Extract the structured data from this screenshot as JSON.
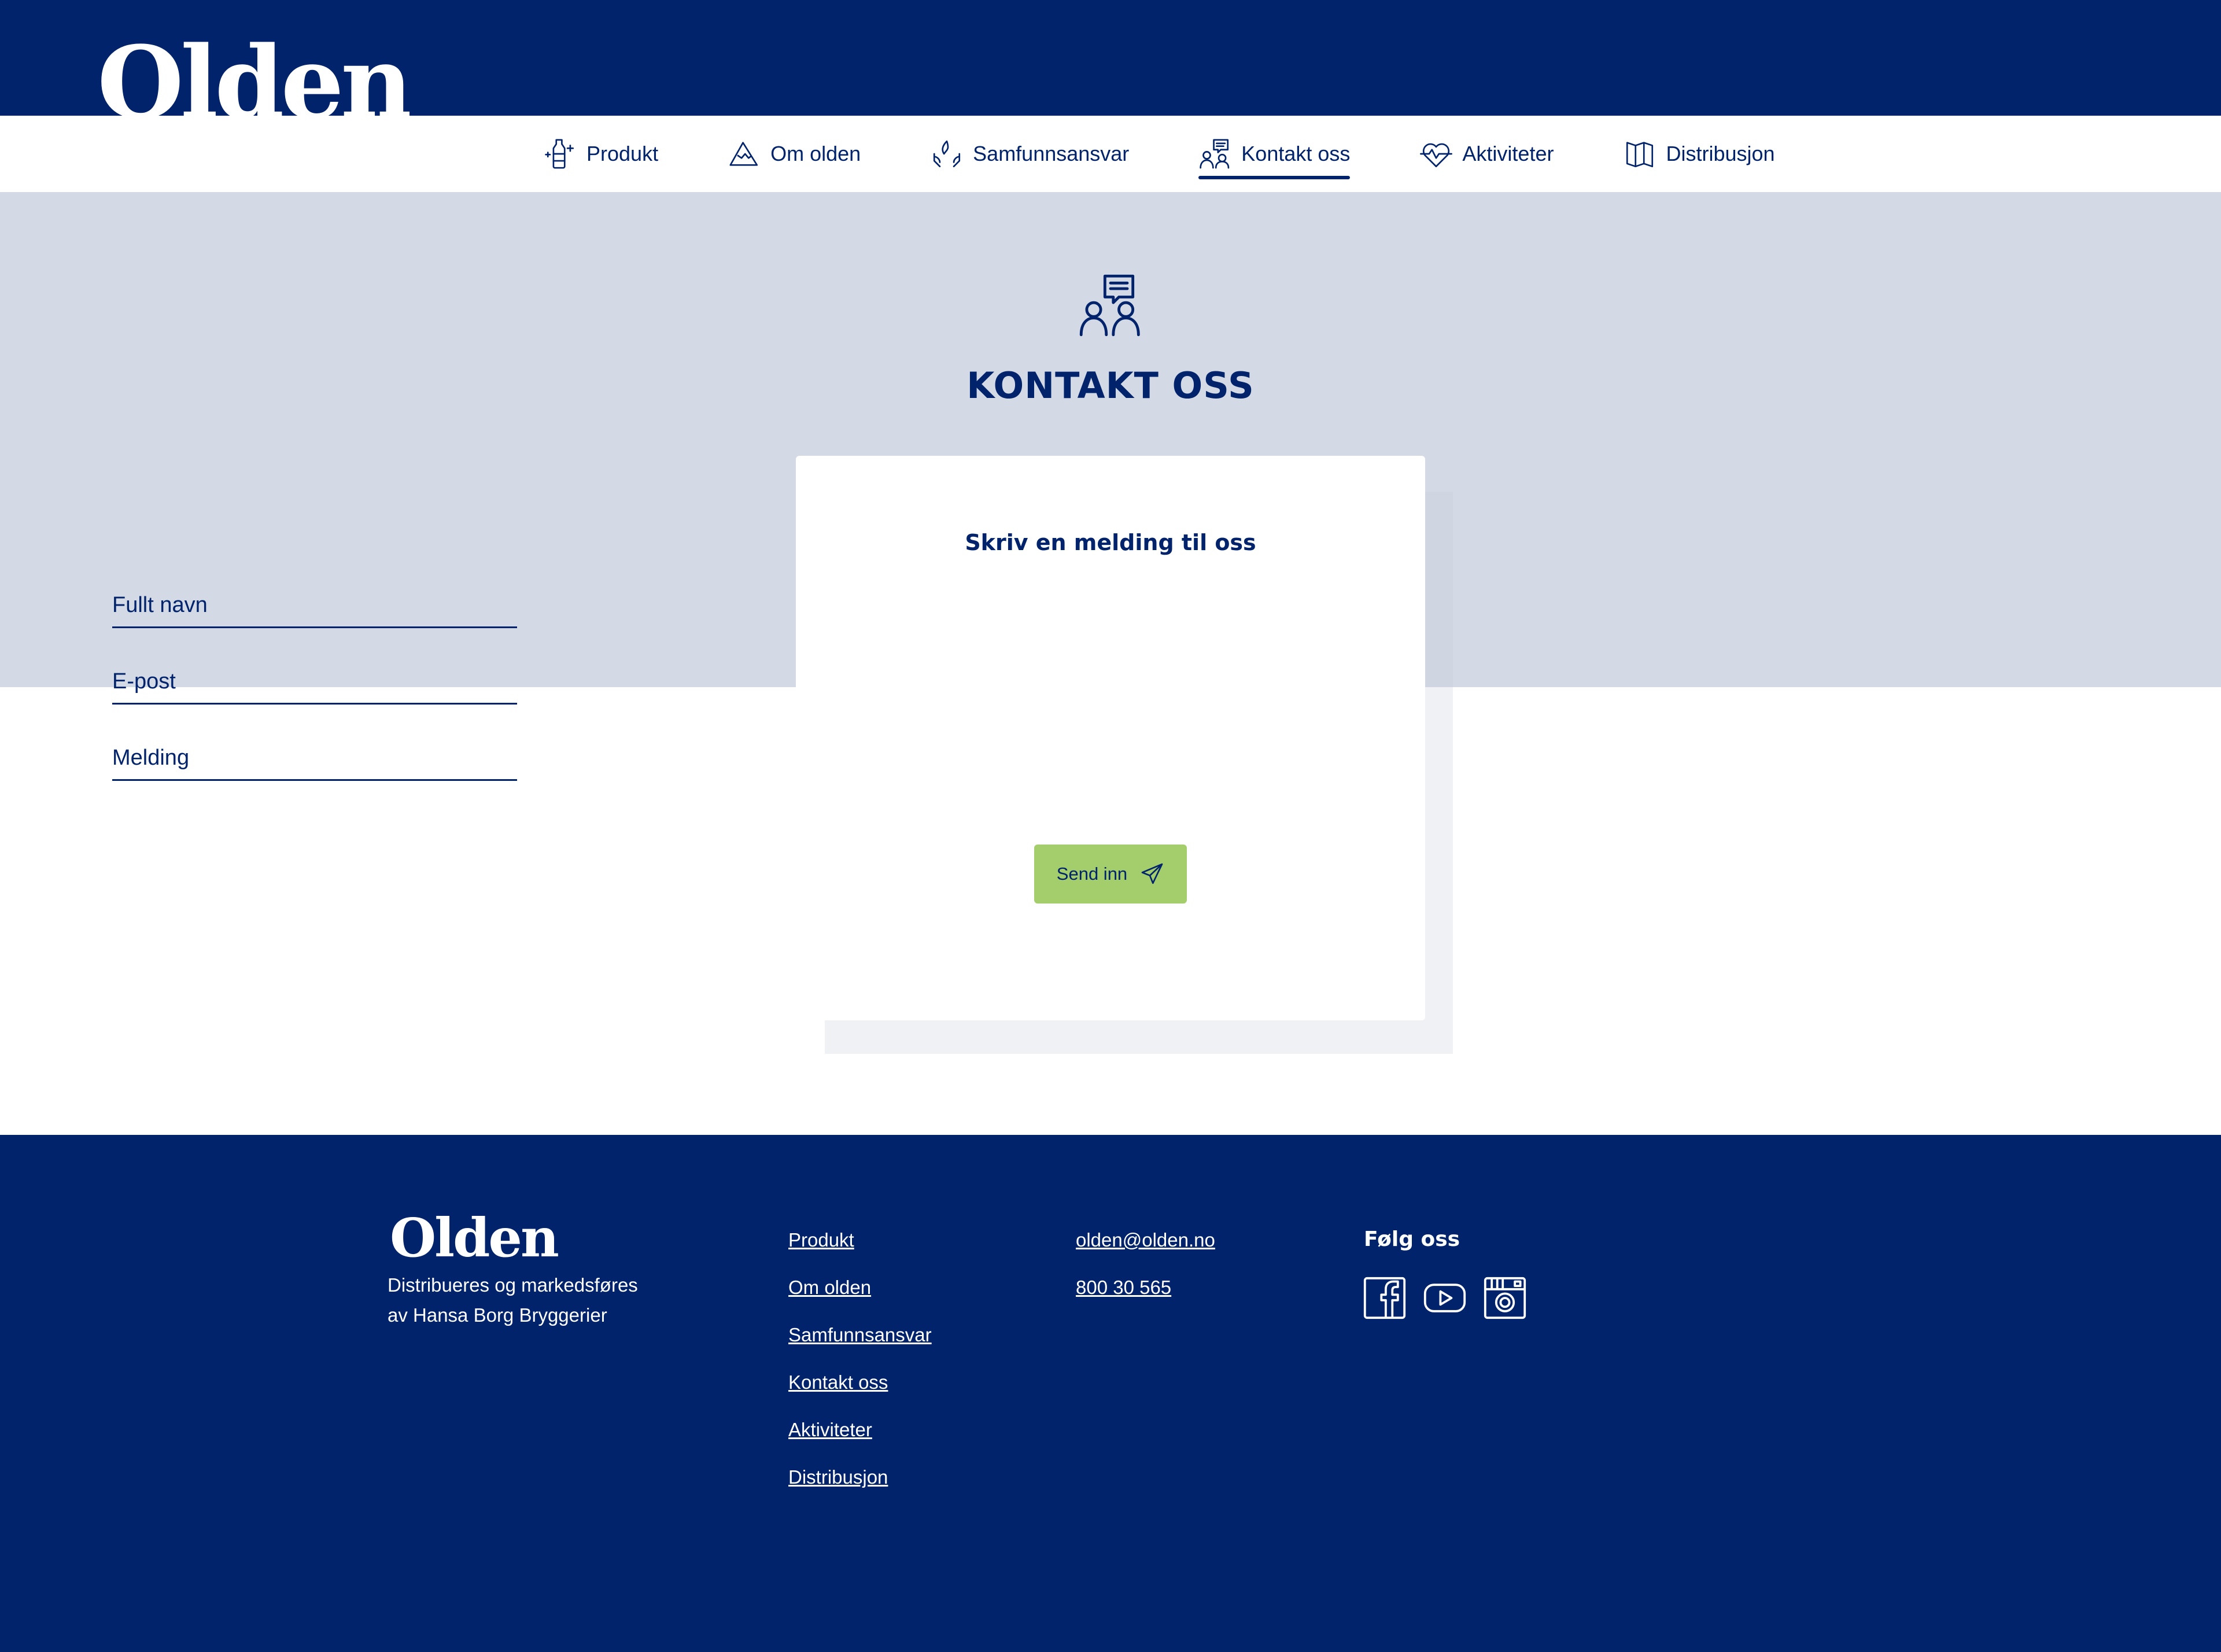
{
  "brand": {
    "logo_text": "Olden"
  },
  "nav": {
    "items": [
      {
        "label": "Produkt",
        "icon": "bottle-sparkle-icon"
      },
      {
        "label": "Om olden",
        "icon": "mountain-icon"
      },
      {
        "label": "Samfunnsansvar",
        "icon": "hands-leaf-icon"
      },
      {
        "label": "Kontakt oss",
        "icon": "people-chat-icon",
        "active": true
      },
      {
        "label": "Aktiviteter",
        "icon": "heart-pulse-icon"
      },
      {
        "label": "Distribusjon",
        "icon": "book-map-icon"
      }
    ]
  },
  "hero": {
    "title": "KONTAKT OSS",
    "icon": "people-chat-icon"
  },
  "form": {
    "title": "Skriv en melding til oss",
    "name_placeholder": "Fullt navn",
    "email_placeholder": "E-post",
    "message_placeholder": "Melding",
    "submit_label": "Send inn",
    "submit_icon": "paper-plane-icon"
  },
  "footer": {
    "logo_text": "Olden",
    "description_line1": "Distribueres og markedsføres",
    "description_line2": "av Hansa Borg Bryggerier",
    "links": [
      "Produkt",
      "Om olden",
      "Samfunnsansvar",
      "Kontakt oss",
      "Aktiviteter",
      "Distribusjon"
    ],
    "email": "olden@olden.no",
    "phone": "800 30 565",
    "follow_title": "Følg oss",
    "social": [
      "facebook-icon",
      "youtube-icon",
      "instagram-icon"
    ]
  },
  "colors": {
    "primary": "#00236b",
    "hero_bg": "#d3d9e5",
    "button": "#a4ce6c",
    "white": "#ffffff"
  }
}
